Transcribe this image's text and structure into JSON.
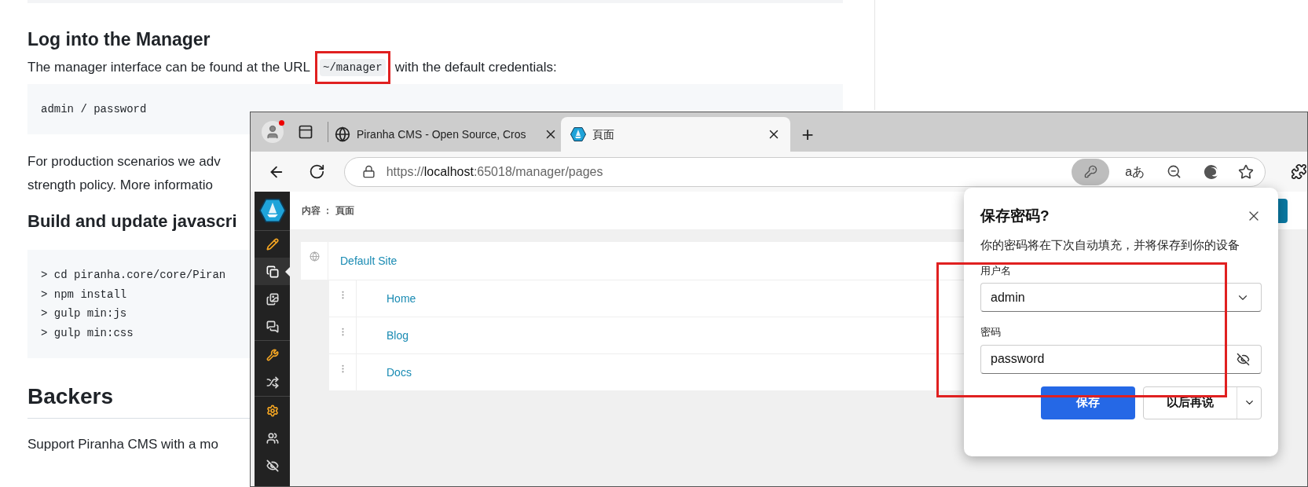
{
  "doc": {
    "heading_1": "Log into the Manager",
    "paragraph_1": {
      "text": "The manager interface can be found at the URL",
      "code": "~/manager",
      "rest": "with the default credentials:"
    },
    "code_block_1": [
      "admin / password"
    ],
    "paragraph_2": [
      "For production scenarios we adv",
      "strength policy. More informatio"
    ],
    "heading_2": "Build and update javascri",
    "code_block_2": [
      "> cd piranha.core/core/Piran",
      "> npm install",
      "> gulp min:js",
      "> gulp min:css"
    ],
    "heading_3": "Backers",
    "paragraph_3": "Support Piranha CMS with a mo"
  },
  "browser": {
    "tabs": [
      {
        "title": "Piranha CMS - Open Source, Cros",
        "selected": false,
        "kind": "globe"
      },
      {
        "title": "頁面",
        "selected": true,
        "kind": "logo"
      }
    ],
    "new_tab": "+",
    "address_bar": {
      "scheme": "https://",
      "host": "localhost",
      "path": ":65018/manager/pages",
      "translate": "aあ"
    }
  },
  "manager": {
    "breadcrumb": "内容 ： 頁面",
    "sidebar": {
      "items": [
        {
          "selected": false
        },
        {
          "selected": true
        },
        {
          "selected": false
        },
        {
          "selected": false
        },
        {
          "selected": false
        },
        {
          "selected": false
        },
        {
          "selected": false
        },
        {
          "selected": false
        },
        {
          "selected": false
        }
      ]
    },
    "site": "Default Site",
    "pages": [
      "Home",
      "Blog",
      "Docs"
    ]
  },
  "save_password_dialog": {
    "title": "保存密码?",
    "description": "你的密码将在下次自动填充，并将保存到你的设备",
    "fields": [
      {
        "label": "用户名",
        "value": "admin",
        "kind": "dropdown"
      },
      {
        "label": "密码",
        "value": "password",
        "kind": "password"
      }
    ],
    "save_button": "保存",
    "later_button": "以后再说"
  }
}
